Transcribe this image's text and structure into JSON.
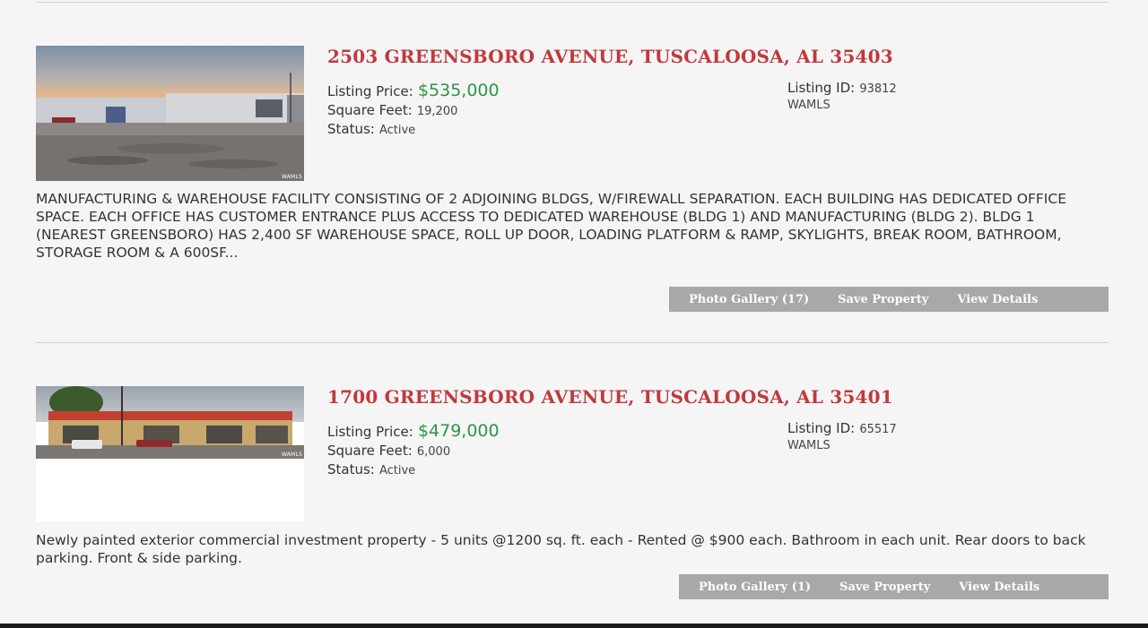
{
  "listings": [
    {
      "address": "2503 GREENSBORO AVENUE, TUSCALOOSA, AL 35403",
      "price_label": "Listing Price:",
      "price": "$535,000",
      "sqft_label": "Square Feet:",
      "sqft": "19,200",
      "status_label": "Status:",
      "status": "Active",
      "id_label": "Listing ID:",
      "id": "93812",
      "mls": "WAMLS",
      "photo_watermark": "WAMLS",
      "description": "MANUFACTURING & WAREHOUSE FACILITY CONSISTING OF 2 ADJOINING BLDGS, W/FIREWALL SEPARATION. EACH BUILDING HAS DEDICATED OFFICE SPACE. EACH OFFICE HAS CUSTOMER ENTRANCE PLUS ACCESS TO DEDICATED WAREHOUSE (BLDG 1) AND MANUFACTURING (BLDG 2). BLDG 1 (NEAREST GREENSBORO) HAS 2,400 SF WAREHOUSE SPACE, ROLL UP DOOR, LOADING PLATFORM & RAMP, SKYLIGHTS, BREAK ROOM, BATHROOM, STORAGE ROOM & A 600SF...",
      "buttons": {
        "gallery": "Photo Gallery (17)",
        "save": "Save Property",
        "details": "View Details"
      }
    },
    {
      "address": "1700 GREENSBORO AVENUE, TUSCALOOSA, AL 35401",
      "price_label": "Listing Price:",
      "price": "$479,000",
      "sqft_label": "Square Feet:",
      "sqft": "6,000",
      "status_label": "Status:",
      "status": "Active",
      "id_label": "Listing ID:",
      "id": "65517",
      "mls": "WAMLS",
      "photo_watermark": "WAMLS",
      "description": "Newly painted exterior commercial investment property - 5 units @1200 sq. ft. each - Rented @ $900 each. Bathroom in each unit. Rear doors to back parking. Front & side parking.",
      "buttons": {
        "gallery": "Photo Gallery (1)",
        "save": "Save Property",
        "details": "View Details"
      }
    }
  ],
  "colors": {
    "background": "#f5f5f6",
    "title": "#c0393d",
    "price": "#2e9447",
    "button_bar": "#a8a8a8"
  }
}
